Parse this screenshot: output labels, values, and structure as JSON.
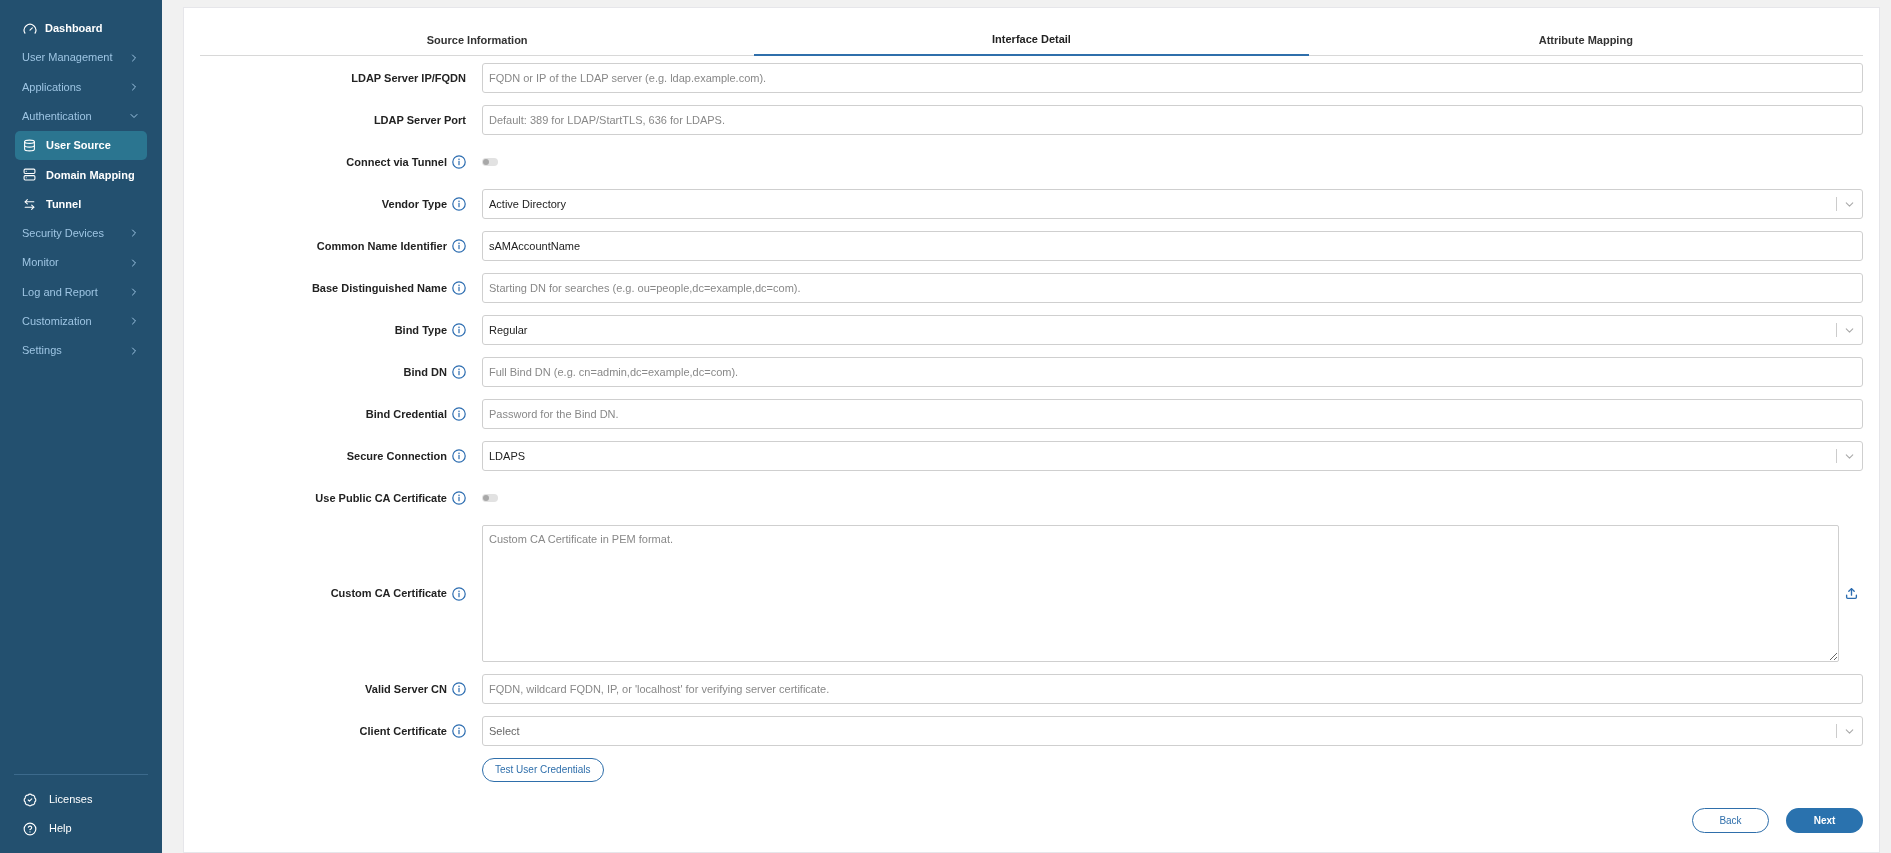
{
  "sidebar": {
    "items": [
      {
        "label": "Dashboard",
        "kind": "link"
      },
      {
        "label": "User Management",
        "kind": "group",
        "expanded": false
      },
      {
        "label": "Applications",
        "kind": "group",
        "expanded": false
      },
      {
        "label": "Authentication",
        "kind": "group",
        "expanded": true,
        "children": [
          {
            "label": "User Source",
            "selected": true
          },
          {
            "label": "Domain Mapping",
            "selected": false
          },
          {
            "label": "Tunnel",
            "selected": false
          }
        ]
      },
      {
        "label": "Security Devices",
        "kind": "group",
        "expanded": false
      },
      {
        "label": "Monitor",
        "kind": "group",
        "expanded": false
      },
      {
        "label": "Log and Report",
        "kind": "group",
        "expanded": false
      },
      {
        "label": "Customization",
        "kind": "group",
        "expanded": false
      },
      {
        "label": "Settings",
        "kind": "group",
        "expanded": false
      }
    ],
    "footer": [
      {
        "label": "Licenses"
      },
      {
        "label": "Help"
      }
    ]
  },
  "tabs": [
    {
      "label": "Source Information",
      "selected": false
    },
    {
      "label": "Interface Detail",
      "selected": true
    },
    {
      "label": "Attribute Mapping",
      "selected": false
    }
  ],
  "fields": [
    {
      "label": "LDAP Server IP/FQDN",
      "info": false,
      "kind": "text",
      "placeholder": "FQDN or IP of the LDAP server (e.g. ldap.example.com)."
    },
    {
      "label": "LDAP Server Port",
      "info": false,
      "kind": "text",
      "placeholder": "Default: 389 for LDAP/StartTLS, 636 for LDAPS."
    },
    {
      "label": "Connect via Tunnel",
      "info": true,
      "kind": "toggle",
      "on": false
    },
    {
      "label": "Vendor Type",
      "info": true,
      "kind": "select",
      "value": "Active Directory"
    },
    {
      "label": "Common Name Identifier",
      "info": true,
      "kind": "text",
      "value": "sAMAccountName"
    },
    {
      "label": "Base Distinguished Name",
      "info": true,
      "kind": "text",
      "placeholder": "Starting DN for searches (e.g. ou=people,dc=example,dc=com)."
    },
    {
      "label": "Bind Type",
      "info": true,
      "kind": "select",
      "value": "Regular"
    },
    {
      "label": "Bind DN",
      "info": true,
      "kind": "text",
      "placeholder": "Full Bind DN (e.g. cn=admin,dc=example,dc=com)."
    },
    {
      "label": "Bind Credential",
      "info": true,
      "kind": "text",
      "placeholder": "Password for the Bind DN."
    },
    {
      "label": "Secure Connection",
      "info": true,
      "kind": "select",
      "value": "LDAPS"
    },
    {
      "label": "Use Public CA Certificate",
      "info": true,
      "kind": "toggle",
      "on": false
    },
    {
      "label": "Custom CA Certificate",
      "info": true,
      "kind": "textarea",
      "placeholder": "Custom CA Certificate in PEM format."
    },
    {
      "label": "Valid Server CN",
      "info": true,
      "kind": "text",
      "placeholder": "FQDN, wildcard FQDN, IP, or 'localhost' for verifying server certificate."
    },
    {
      "label": "Client Certificate",
      "info": true,
      "kind": "select",
      "placeholder": "Select"
    }
  ],
  "test_button": "Test User Credentials",
  "buttons": [
    {
      "label": "Back",
      "kind": "secondary"
    },
    {
      "label": "Next",
      "kind": "primary"
    }
  ]
}
